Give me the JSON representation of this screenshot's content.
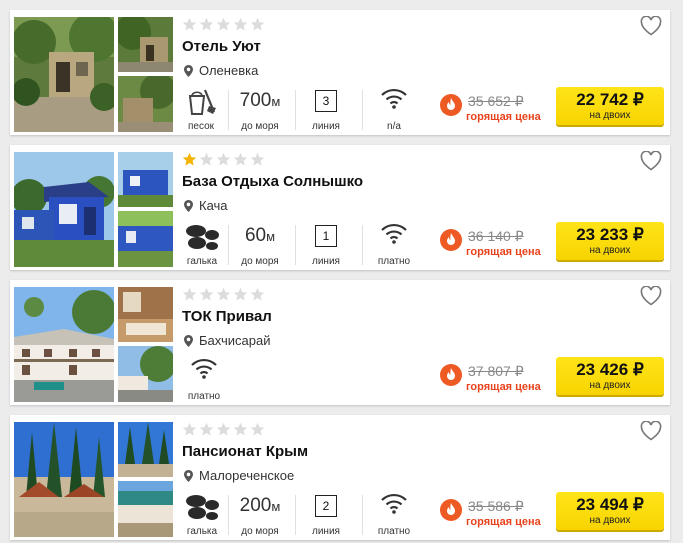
{
  "currency_color": "#e8431c",
  "accent_button": "#f7d400",
  "hotels": [
    {
      "stars": 0,
      "name": "Отель Уют",
      "location": "Оленевка",
      "beach": {
        "icon": "sand-bucket-icon",
        "label": "песок"
      },
      "distance": {
        "value": "700",
        "unit": "м",
        "label": "до моря"
      },
      "line": {
        "value": "3",
        "label": "линия"
      },
      "wifi": {
        "label": "n/a"
      },
      "old_price": "35 652 ₽",
      "hot_label": "горящая цена",
      "price": "22 742 ₽",
      "price_note": "на двоих"
    },
    {
      "stars": 1,
      "name": "База Отдыха Солнышко",
      "location": "Кача",
      "beach": {
        "icon": "pebbles-icon",
        "label": "галька"
      },
      "distance": {
        "value": "60",
        "unit": "м",
        "label": "до моря"
      },
      "line": {
        "value": "1",
        "label": "линия"
      },
      "wifi": {
        "label": "платно"
      },
      "old_price": "36 140 ₽",
      "hot_label": "горящая цена",
      "price": "23 233 ₽",
      "price_note": "на двоих"
    },
    {
      "stars": 0,
      "name": "ТОК Привал",
      "location": "Бахчисарай",
      "wifi": {
        "label": "платно"
      },
      "old_price": "37 807 ₽",
      "hot_label": "горящая цена",
      "price": "23 426 ₽",
      "price_note": "на двоих"
    },
    {
      "stars": 0,
      "name": "Пансионат Крым",
      "location": "Малореченское",
      "beach": {
        "icon": "pebbles-icon",
        "label": "галька"
      },
      "distance": {
        "value": "200",
        "unit": "м",
        "label": "до моря"
      },
      "line": {
        "value": "2",
        "label": "линия"
      },
      "wifi": {
        "label": "платно"
      },
      "old_price": "35 586 ₽",
      "hot_label": "горящая цена",
      "price": "23 494 ₽",
      "price_note": "на двоих"
    }
  ]
}
